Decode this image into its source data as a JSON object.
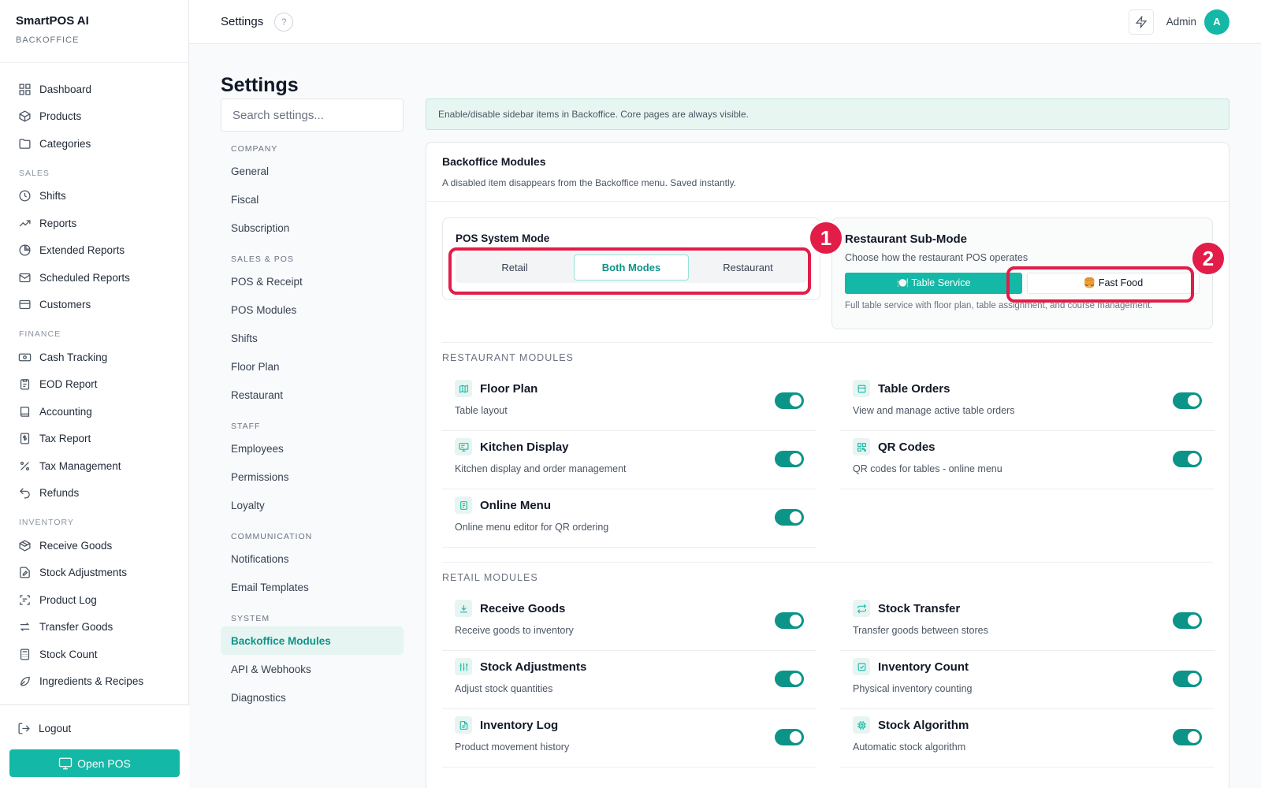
{
  "brand": {
    "title": "SmartPOS AI",
    "subtitle": "BACKOFFICE"
  },
  "sidebar": {
    "groups": [
      {
        "section": "",
        "items": [
          {
            "label": "Dashboard",
            "icon": "grid-icon"
          },
          {
            "label": "Products",
            "icon": "box-icon"
          },
          {
            "label": "Categories",
            "icon": "folder-icon"
          }
        ]
      },
      {
        "section": "SALES",
        "items": [
          {
            "label": "Shifts",
            "icon": "clock-icon"
          },
          {
            "label": "Reports",
            "icon": "trend-icon"
          },
          {
            "label": "Extended Reports",
            "icon": "pie-icon"
          },
          {
            "label": "Scheduled Reports",
            "icon": "mail-icon"
          },
          {
            "label": "Customers",
            "icon": "card-icon"
          }
        ]
      },
      {
        "section": "FINANCE",
        "items": [
          {
            "label": "Cash Tracking",
            "icon": "cash-icon"
          },
          {
            "label": "EOD Report",
            "icon": "clipboard-icon"
          },
          {
            "label": "Accounting",
            "icon": "book-icon"
          },
          {
            "label": "Tax Report",
            "icon": "dollar-doc-icon"
          },
          {
            "label": "Tax Management",
            "icon": "percent-icon"
          },
          {
            "label": "Refunds",
            "icon": "undo-icon"
          }
        ]
      },
      {
        "section": "INVENTORY",
        "items": [
          {
            "label": "Receive Goods",
            "icon": "package-icon"
          },
          {
            "label": "Stock Adjustments",
            "icon": "doc-edit-icon"
          },
          {
            "label": "Product Log",
            "icon": "scan-icon"
          },
          {
            "label": "Transfer Goods",
            "icon": "transfer-icon"
          },
          {
            "label": "Stock Count",
            "icon": "calculator-icon"
          },
          {
            "label": "Ingredients & Recipes",
            "icon": "leaf-icon"
          }
        ]
      }
    ],
    "logout": "Logout",
    "open_pos": "Open POS"
  },
  "header": {
    "title": "Settings",
    "help": "?",
    "user": "Admin",
    "avatar": "A"
  },
  "settings_nav": {
    "title": "Settings",
    "search_placeholder": "Search settings...",
    "groups": [
      {
        "section": "COMPANY",
        "items": [
          "General",
          "Fiscal",
          "Subscription"
        ]
      },
      {
        "section": "SALES & POS",
        "items": [
          "POS & Receipt",
          "POS Modules",
          "Shifts",
          "Floor Plan",
          "Restaurant"
        ]
      },
      {
        "section": "STAFF",
        "items": [
          "Employees",
          "Permissions",
          "Loyalty"
        ]
      },
      {
        "section": "COMMUNICATION",
        "items": [
          "Notifications",
          "Email Templates"
        ]
      },
      {
        "section": "SYSTEM",
        "items": [
          "Backoffice Modules",
          "API & Webhooks",
          "Diagnostics"
        ]
      }
    ],
    "active": "Backoffice Modules"
  },
  "main": {
    "banner": "Enable/disable sidebar items in Backoffice. Core pages are always visible.",
    "card_title": "Backoffice Modules",
    "card_sub": "A disabled item disappears from the Backoffice menu. Saved instantly.",
    "pos_mode": {
      "label": "POS System Mode",
      "options": [
        "Retail",
        "Both Modes",
        "Restaurant"
      ],
      "active": "Both Modes"
    },
    "sub_mode": {
      "title": "Restaurant Sub-Mode",
      "desc": "Choose how the restaurant POS operates",
      "options": [
        "🍽️ Table Service",
        "🍔 Fast Food"
      ],
      "active": "🍽️ Table Service",
      "note": "Full table service with floor plan, table assignment, and course management."
    },
    "markers": [
      "1",
      "2"
    ],
    "restaurant_title": "RESTAURANT MODULES",
    "restaurant_modules": [
      {
        "name": "Floor Plan",
        "desc": "Table layout",
        "icon": "map-icon",
        "enabled": true
      },
      {
        "name": "Table Orders",
        "desc": "View and manage active table orders",
        "icon": "table-icon",
        "enabled": true
      },
      {
        "name": "Kitchen Display",
        "desc": "Kitchen display and order management",
        "icon": "monitor-icon",
        "enabled": true
      },
      {
        "name": "QR Codes",
        "desc": "QR codes for tables - online menu",
        "icon": "qr-icon",
        "enabled": true
      },
      {
        "name": "Online Menu",
        "desc": "Online menu editor for QR ordering",
        "icon": "menu-doc-icon",
        "enabled": true
      }
    ],
    "retail_title": "RETAIL MODULES",
    "retail_modules": [
      {
        "name": "Receive Goods",
        "desc": "Receive goods to inventory",
        "icon": "download-icon",
        "enabled": true
      },
      {
        "name": "Stock Transfer",
        "desc": "Transfer goods between stores",
        "icon": "repeat-icon",
        "enabled": true
      },
      {
        "name": "Stock Adjustments",
        "desc": "Adjust stock quantities",
        "icon": "sliders-icon",
        "enabled": true
      },
      {
        "name": "Inventory Count",
        "desc": "Physical inventory counting",
        "icon": "check-square-icon",
        "enabled": true
      },
      {
        "name": "Inventory Log",
        "desc": "Product movement history",
        "icon": "file-icon",
        "enabled": true
      },
      {
        "name": "Stock Algorithm",
        "desc": "Automatic stock algorithm",
        "icon": "cpu-icon",
        "enabled": true
      }
    ]
  },
  "colors": {
    "accent": "#14b8a6",
    "accent_dark": "#0d9488",
    "highlight": "#e11d48"
  }
}
